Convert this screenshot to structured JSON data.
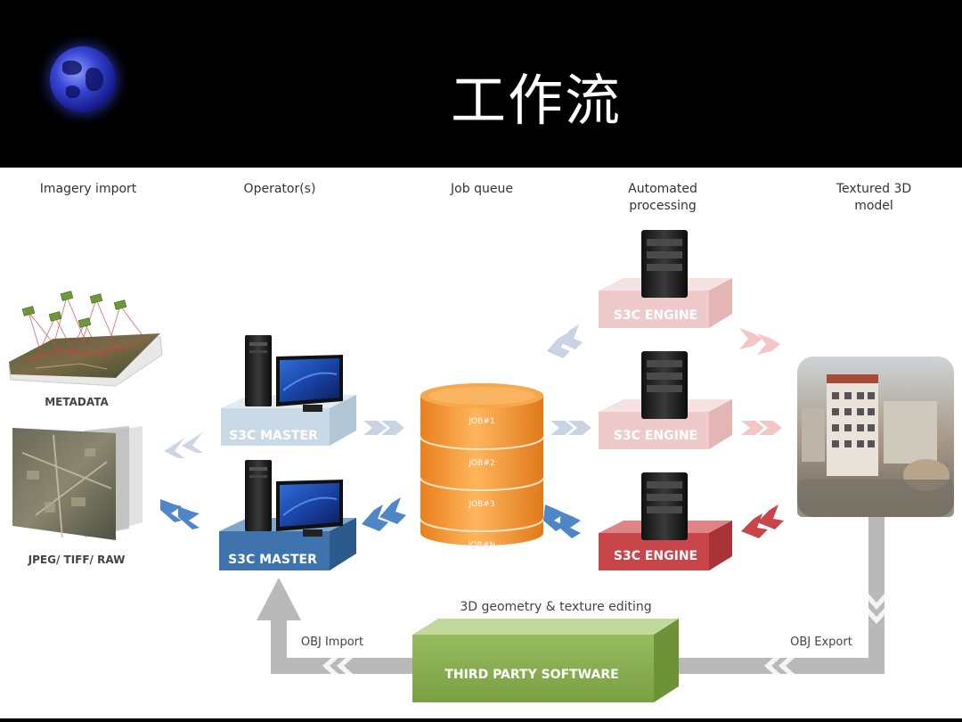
{
  "slide": {
    "title": "工作流"
  },
  "columns": {
    "imagery_import": "Imagery import",
    "operators": "Operator(s)",
    "job_queue": "Job queue",
    "automated_line1": "Automated",
    "automated_line2": "processing",
    "textured_line1": "Textured 3D",
    "textured_line2": "model"
  },
  "inputs": {
    "metadata": "METADATA",
    "formats": "JPEG/ TIFF/ RAW"
  },
  "masters": {
    "top": "S3C MASTER",
    "bottom": "S3C MASTER"
  },
  "jobs": [
    "JOB#1",
    "JOB#2",
    "JOB#3",
    "JOB#N"
  ],
  "engines": {
    "top": "S3C ENGINE",
    "middle": "S3C ENGINE",
    "bottom": "S3C ENGINE"
  },
  "loop": {
    "editing": "3D geometry & texture editing",
    "obj_import": "OBJ Import",
    "obj_export": "OBJ Export",
    "third_party": "THIRD PARTY SOFTWARE"
  },
  "colors": {
    "master_light": "#c9d9e6",
    "master_blue": "#3e73ad",
    "engine_pink": "#efcaca",
    "engine_red": "#c8454a",
    "job_orange": "#f59c3a",
    "software_green": "#8db254",
    "arrow_blue": "#4f86c6",
    "arrow_gray": "#b9b9b9"
  }
}
